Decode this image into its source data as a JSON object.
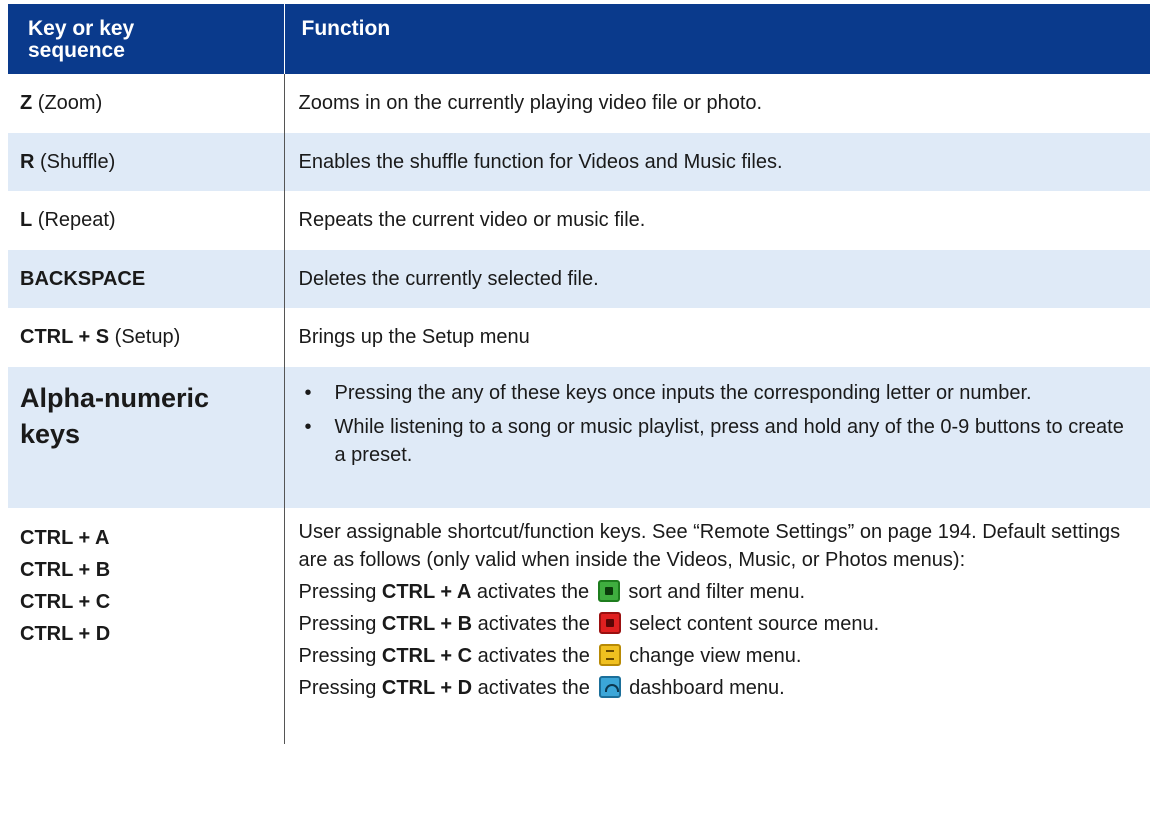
{
  "headers": {
    "key": "Key or key sequence",
    "function": "Function"
  },
  "rows": [
    {
      "key": "Z",
      "key_paren": "(Zoom)",
      "function": "Zooms in on the currently playing video file or photo."
    },
    {
      "key": "R",
      "key_paren": "(Shuffle)",
      "function": "Enables the shuffle function for Videos and Music files."
    },
    {
      "key": "L",
      "key_paren": "(Repeat)",
      "function": "Repeats the current video or music file."
    },
    {
      "key": "BACKSPACE",
      "function": "Deletes the currently selected file."
    },
    {
      "key": "CTRL + S",
      "key_paren": "(Setup)",
      "function": "Brings up the Setup menu"
    }
  ],
  "alpha": {
    "key": "Alpha-numeric keys",
    "bullets": [
      "Pressing the any of these keys once inputs the corresponding letter or number.",
      "While listening to a song or music playlist, press and hold any of the 0-9 buttons to create a preset."
    ]
  },
  "ctrl": {
    "keys": [
      "CTRL + A",
      "CTRL + B",
      "CTRL + C",
      "CTRL + D"
    ],
    "intro": "User assignable shortcut/function keys. See “Remote Settings” on page 194. Default settings are as follows (only valid when inside the Videos, Music, or Photos menus):",
    "items": [
      {
        "pre": "Pressing",
        "key": "CTRL + A",
        "mid": "activates the",
        "icon": "sort-filter-icon",
        "post": "sort and filter menu."
      },
      {
        "pre": "Pressing",
        "key": "CTRL + B",
        "mid": "activates the",
        "icon": "content-source-icon",
        "post": "select content source menu."
      },
      {
        "pre": "Pressing",
        "key": "CTRL + C",
        "mid": "activates the",
        "icon": "change-view-icon",
        "post": "change view menu."
      },
      {
        "pre": "Pressing",
        "key": "CTRL + D",
        "mid": "activates the",
        "icon": "dashboard-icon",
        "post": "dashboard menu."
      }
    ]
  },
  "colors": {
    "header_bg": "#0a3a8c",
    "row_shade": "#dfeaf7",
    "sort_icon": "#3fae3f",
    "source_icon": "#e02020",
    "view_icon": "#f0c020",
    "dashboard_icon": "#3ba6d8"
  }
}
